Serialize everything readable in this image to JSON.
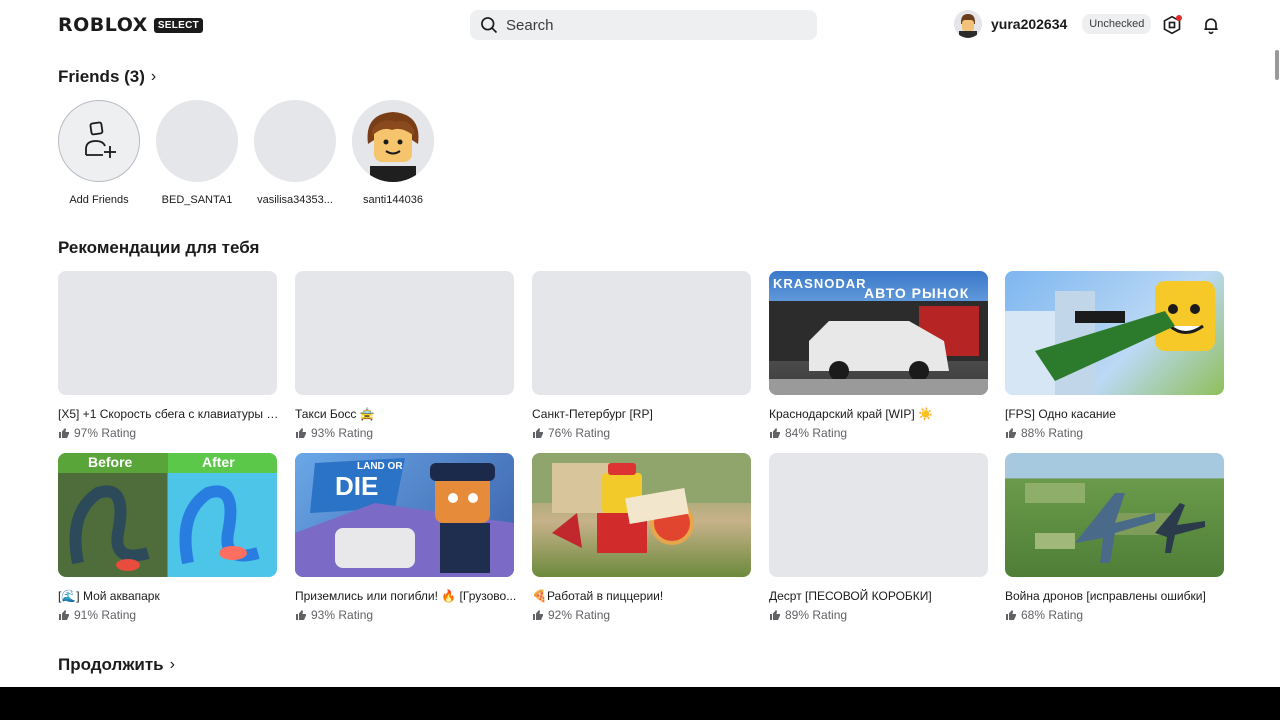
{
  "header": {
    "logo_text": "ROBLOX",
    "logo_badge": "SELECT",
    "search_placeholder": "Search",
    "username": "yura202634",
    "status_badge": "Unchecked"
  },
  "friends": {
    "title": "Friends (3)",
    "chevron": "›",
    "items": [
      {
        "name": "Add Friends"
      },
      {
        "name": "BED_SANTA1"
      },
      {
        "name": "vasilisa34353..."
      },
      {
        "name": "santi144036"
      }
    ]
  },
  "recommendations": {
    "title": "Рекомендации для тебя",
    "games": [
      {
        "title": "[X5] +1 Скорость сбега с клавиатуры | ...",
        "rating": "97% Rating"
      },
      {
        "title": "Такси Босс 🚖",
        "rating": "93% Rating"
      },
      {
        "title": "Санкт-Петербург [RP]",
        "rating": "76% Rating"
      },
      {
        "title": "Краснодарский край [WIP] ☀️",
        "rating": "84% Rating",
        "thumb_text_1": "KRASNODAR",
        "thumb_text_2": "АВТО РЫНОК"
      },
      {
        "title": "[FPS] Одно касание",
        "rating": "88% Rating"
      },
      {
        "title": "[🌊] Мой аквапарк",
        "rating": "91% Rating",
        "thumb_text_1": "Before",
        "thumb_text_2": "After"
      },
      {
        "title": "Приземлись или погибли! 🔥 [Грузово...",
        "rating": "93% Rating",
        "thumb_text_1": "LAND OR",
        "thumb_text_2": "DIE"
      },
      {
        "title": "🍕Работай в пиццерии!",
        "rating": "92% Rating"
      },
      {
        "title": "Десрт [ПЕСОВОЙ КОРОБКИ]",
        "rating": "89% Rating"
      },
      {
        "title": "Война дронов [исправлены ошибки]",
        "rating": "68% Rating"
      }
    ]
  },
  "continue": {
    "title": "Продолжить",
    "chevron": "›"
  }
}
